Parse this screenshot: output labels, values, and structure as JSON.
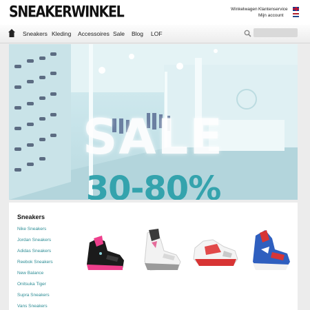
{
  "header": {
    "logo": "SNEAKERWINKEL",
    "links": {
      "cart": "Winkelwagen",
      "service": "Klantenservice",
      "account": "Mijn account"
    }
  },
  "nav": {
    "items": [
      "Sneakers",
      "Kleding",
      "Accessoires",
      "Sale",
      "Blog",
      "LOF"
    ]
  },
  "search": {
    "placeholder": ""
  },
  "hero": {
    "sale_text": "SALE",
    "discount_text": "30-80%"
  },
  "sidebar": {
    "title": "Sneakers",
    "links": [
      "Nike Sneakers",
      "Jordan Sneakers",
      "Adidas Sneakers",
      "Reebok Sneakers",
      "New Balance",
      "Onitsuka Tiger",
      "Supra Sneakers",
      "Vans Sneakers"
    ]
  },
  "colors": {
    "accent": "#34a3ad",
    "link": "#2d8d95"
  }
}
